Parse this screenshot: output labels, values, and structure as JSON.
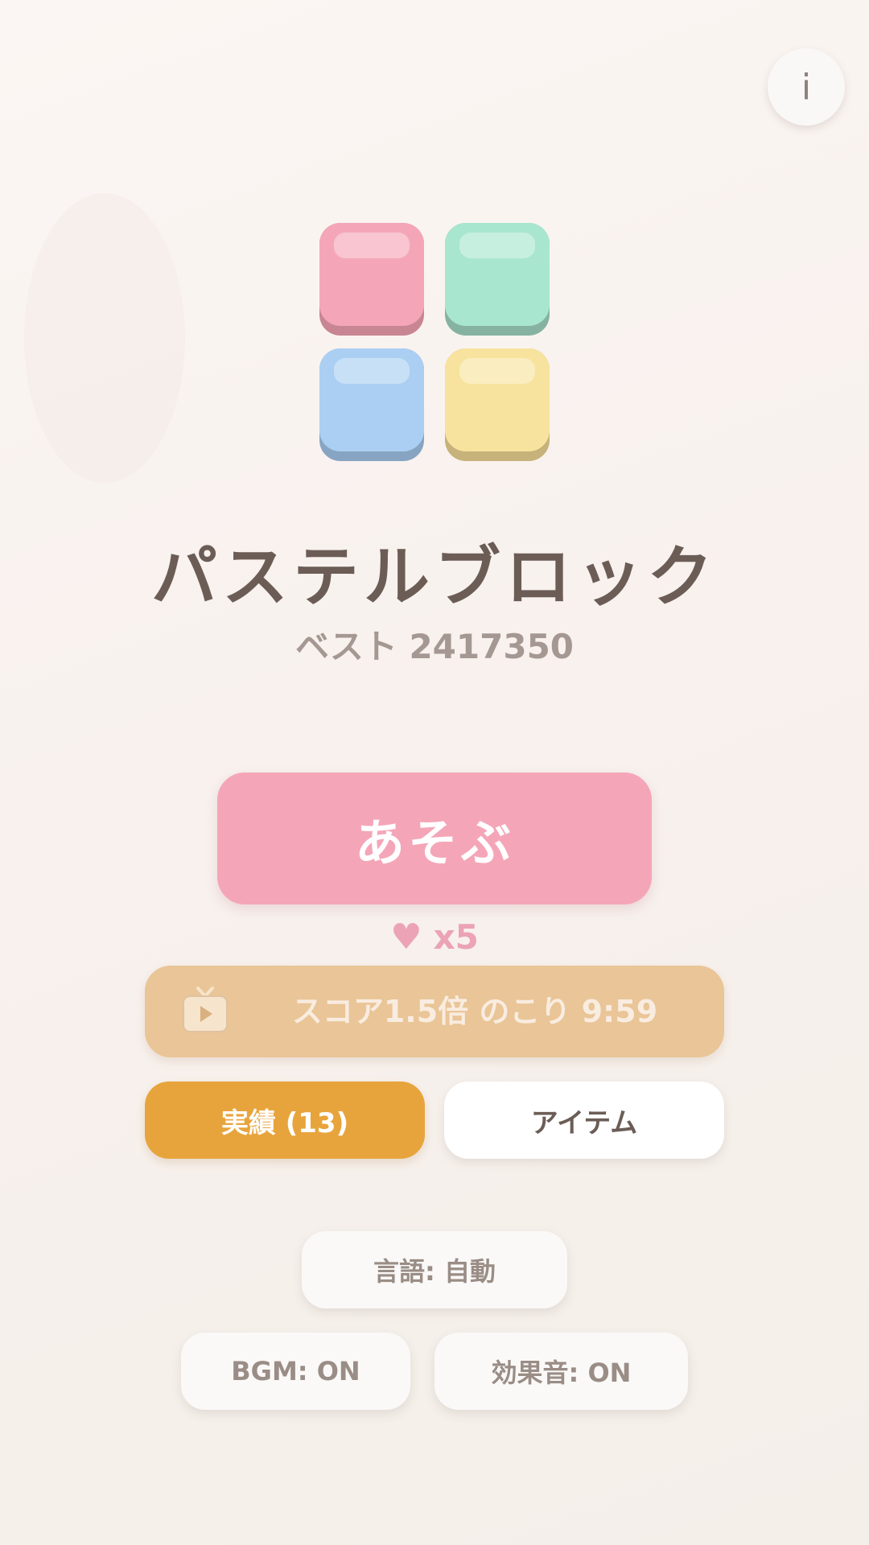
{
  "header": {
    "info_label": "i"
  },
  "logo": {
    "tiles": [
      {
        "name": "pink",
        "face": "#f4a6b8",
        "edge": "#c88592"
      },
      {
        "name": "mint",
        "face": "#a9e6cf",
        "edge": "#86b3a1"
      },
      {
        "name": "blue",
        "face": "#aacff2",
        "edge": "#87a5c2"
      },
      {
        "name": "yellow",
        "face": "#f7e39d",
        "edge": "#c6b27a"
      }
    ]
  },
  "title": "パステルブロック",
  "best_score": "ベスト 2417350",
  "play": {
    "label": "あそぶ"
  },
  "lives": {
    "icon": "heart-icon",
    "count": "x5"
  },
  "boost": {
    "icon": "tv-play-icon",
    "text": "スコア1.5倍 のこり 9:59"
  },
  "buttons": {
    "achievements": "実績 (13)",
    "items": "アイテム",
    "language": "言語: 自動",
    "bgm": "BGM: ON",
    "sfx": "効果音: ON"
  },
  "colors": {
    "accent_pink": "#f4a6b8",
    "accent_orange": "#e8a43c",
    "boost_tan": "#e9c597",
    "title_text": "#6b5d56"
  }
}
